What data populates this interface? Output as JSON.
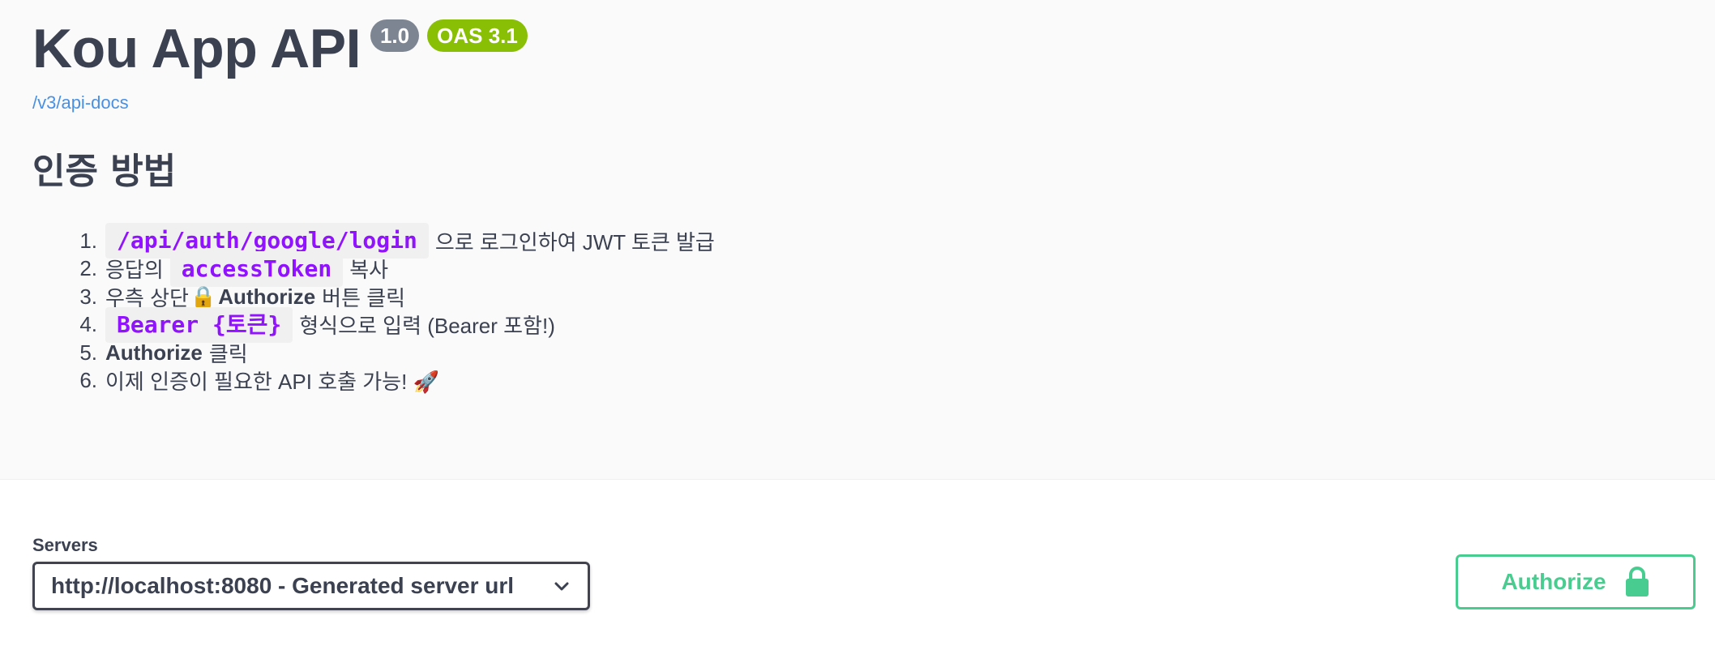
{
  "header": {
    "title": "Kou App API",
    "version_badge": "1.0",
    "oas_badge": "OAS 3.1",
    "doc_link": "/v3/api-docs"
  },
  "auth_guide": {
    "heading": "인증 방법",
    "steps": [
      {
        "num": "1.",
        "code": "/api/auth/google/login",
        "text": "으로 로그인하여 JWT 토큰 발급"
      },
      {
        "num": "2.",
        "pre": "응답의",
        "code": "accessToken",
        "text": "복사"
      },
      {
        "num": "3.",
        "pre": "우측 상단",
        "lock": "🔒",
        "strong": "Authorize",
        "text": "버튼 클릭"
      },
      {
        "num": "4.",
        "code": "Bearer {토큰}",
        "text": "형식으로 입력 (Bearer 포함!)"
      },
      {
        "num": "5.",
        "strong": "Authorize",
        "text": "클릭"
      },
      {
        "num": "6.",
        "text": "이제 인증이 필요한 API 호출 가능! 🚀"
      }
    ]
  },
  "servers": {
    "label": "Servers",
    "selected": "http://localhost:8080 - Generated server url"
  },
  "authorize_button": {
    "label": "Authorize",
    "icon": "lock-icon"
  },
  "colors": {
    "accent_green": "#49cc90",
    "oas_badge": "#89bf04",
    "version_badge": "#7d8492",
    "code_text": "#9012fe",
    "link": "#4990e2"
  }
}
